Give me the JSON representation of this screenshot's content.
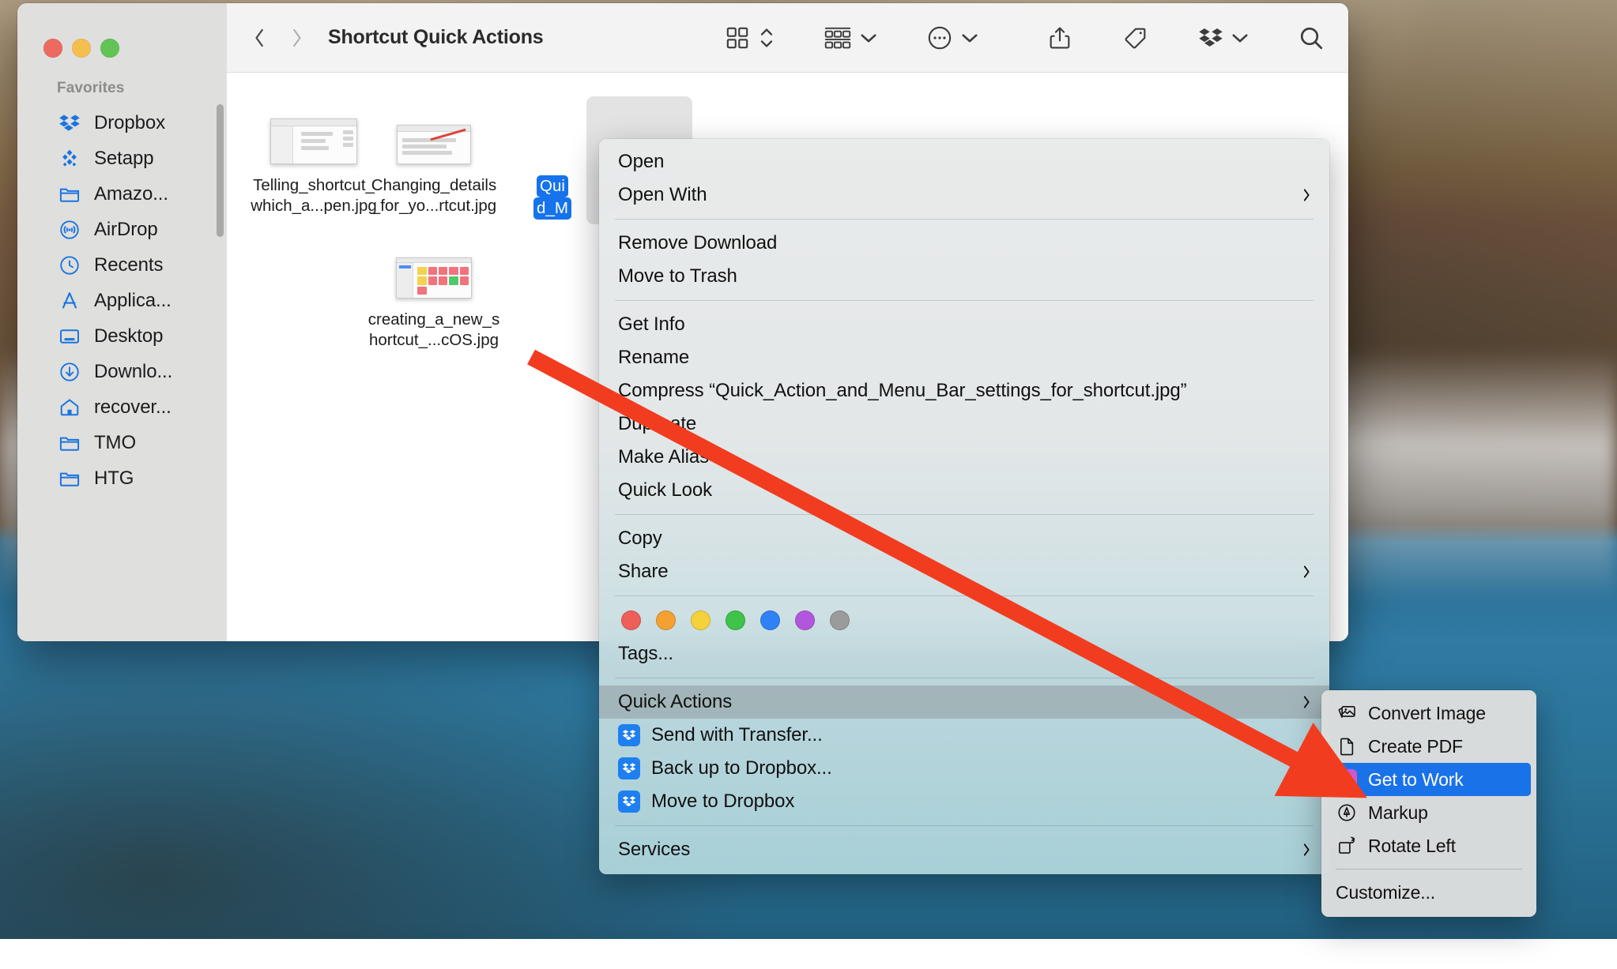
{
  "window": {
    "title": "Shortcut Quick Actions",
    "traffic_lights": [
      "close",
      "minimize",
      "zoom"
    ]
  },
  "toolbar": {
    "back_icon": "chevron-left-icon",
    "forward_icon": "chevron-right-icon",
    "view_icon": "icon-view-grid-icon",
    "view_stepper_icon": "chevron-up-down-icon",
    "group_icon": "group-by-icon",
    "group_chevron_icon": "chevron-down-icon",
    "more_icon": "ellipsis-circle-icon",
    "more_chevron_icon": "chevron-down-icon",
    "share_icon": "share-icon",
    "tag_icon": "tag-icon",
    "dropbox_icon": "dropbox-icon",
    "dropbox_chevron_icon": "chevron-down-icon",
    "search_icon": "search-icon"
  },
  "sidebar": {
    "section_title": "Favorites",
    "items": [
      {
        "label": "Dropbox",
        "icon": "dropbox-icon"
      },
      {
        "label": "Setapp",
        "icon": "setapp-icon"
      },
      {
        "label": "Amazo...",
        "icon": "folder-icon"
      },
      {
        "label": "AirDrop",
        "icon": "airdrop-icon"
      },
      {
        "label": "Recents",
        "icon": "clock-icon"
      },
      {
        "label": "Applica...",
        "icon": "applications-icon"
      },
      {
        "label": "Desktop",
        "icon": "desktop-icon"
      },
      {
        "label": "Downlo...",
        "icon": "downloads-icon"
      },
      {
        "label": "recover...",
        "icon": "home-icon"
      },
      {
        "label": "TMO",
        "icon": "folder-icon"
      },
      {
        "label": "HTG",
        "icon": "folder-icon"
      }
    ]
  },
  "files": [
    {
      "name_line1": "Telling_shortcut_",
      "name_line2": "which_a...pen.jpg",
      "selected": false,
      "thumb": "finder-window-screenshot"
    },
    {
      "name_line1": "Changing_details",
      "name_line2": "_for_yo...rtcut.jpg",
      "selected": false,
      "thumb": "list-document-screenshot"
    },
    {
      "name_line1": "Qui",
      "name_line2": "d_M",
      "selected": true,
      "thumb": "selected-file-thumb"
    },
    {
      "name_line1": "creating_a_new_s",
      "name_line2": "hortcut_...cOS.jpg",
      "selected": false,
      "thumb": "shortcuts-grid-screenshot"
    }
  ],
  "context_menu": {
    "groups": [
      {
        "items": [
          {
            "label": "Open",
            "submenu": false
          },
          {
            "label": "Open With",
            "submenu": true
          }
        ]
      },
      {
        "items": [
          {
            "label": "Remove Download",
            "submenu": false
          },
          {
            "label": "Move to Trash",
            "submenu": false
          }
        ]
      },
      {
        "items": [
          {
            "label": "Get Info",
            "submenu": false
          },
          {
            "label": "Rename",
            "submenu": false
          },
          {
            "label": "Compress “Quick_Action_and_Menu_Bar_settings_for_shortcut.jpg”",
            "submenu": false
          },
          {
            "label": "Duplicate",
            "submenu": false
          },
          {
            "label": "Make Alias",
            "submenu": false
          },
          {
            "label": "Quick Look",
            "submenu": false
          }
        ]
      },
      {
        "items": [
          {
            "label": "Copy",
            "submenu": false
          },
          {
            "label": "Share",
            "submenu": true
          }
        ]
      }
    ],
    "tag_colors": [
      "#ef5f5a",
      "#f4a033",
      "#f5d13c",
      "#3fc34b",
      "#2f82f5",
      "#b257dd",
      "#9b9b9b"
    ],
    "tags_label": "Tags...",
    "quick_actions_label": "Quick Actions",
    "quick_actions_highlighted": true,
    "dropbox_actions": [
      {
        "label": "Send with Transfer...",
        "icon": "dropbox-icon"
      },
      {
        "label": "Back up to Dropbox...",
        "icon": "dropbox-icon"
      },
      {
        "label": "Move to Dropbox",
        "icon": "dropbox-icon"
      }
    ],
    "services_label": "Services"
  },
  "submenu": {
    "items": [
      {
        "label": "Convert Image",
        "icon": "photos-stack-icon",
        "selected": false
      },
      {
        "label": "Create PDF",
        "icon": "document-icon",
        "selected": false
      },
      {
        "label": "Get to Work",
        "icon": "shortcuts-app-icon",
        "selected": true
      },
      {
        "label": "Markup",
        "icon": "markup-pen-icon",
        "selected": false
      },
      {
        "label": "Rotate Left",
        "icon": "rotate-left-icon",
        "selected": false
      }
    ],
    "customize_label": "Customize..."
  },
  "annotation": {
    "arrow_color": "#f23c20",
    "description": "red-arrow-pointing-to-get-to-work"
  },
  "colors": {
    "accent_blue": "#1a72e8",
    "selection_blue": "#1673ec",
    "sidebar_icon_blue": "#1a74e0",
    "dropbox_blue": "#1e7ff0"
  }
}
